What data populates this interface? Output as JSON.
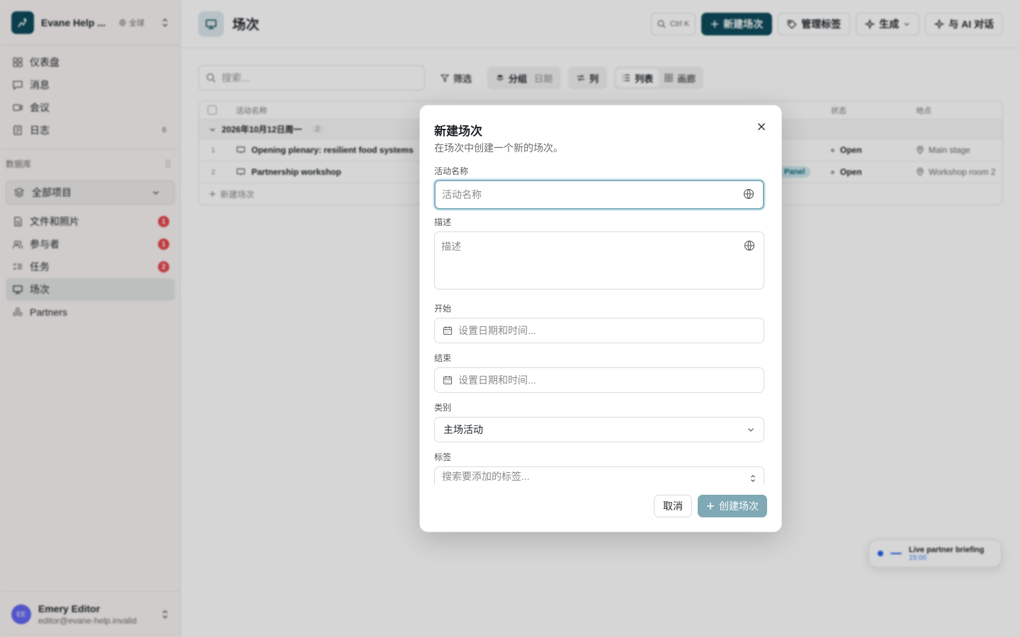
{
  "workspace": {
    "name": "Evane Help ...",
    "scope": "全球"
  },
  "nav": [
    {
      "label": "仪表盘",
      "icon": "dashboard-icon"
    },
    {
      "label": "消息",
      "icon": "message-icon"
    },
    {
      "label": "会议",
      "icon": "video-icon"
    },
    {
      "label": "日志",
      "icon": "log-icon",
      "count": "6"
    }
  ],
  "database": {
    "label": "数据库",
    "project_select": "全部项目",
    "items": [
      {
        "label": "文件和照片",
        "icon": "file-icon",
        "badge": "1"
      },
      {
        "label": "参与者",
        "icon": "users-icon",
        "badge": "1"
      },
      {
        "label": "任务",
        "icon": "tasks-icon",
        "badge": "2"
      },
      {
        "label": "场次",
        "icon": "presentation-icon",
        "active": true
      },
      {
        "label": "Partners",
        "icon": "partners-icon"
      }
    ]
  },
  "user": {
    "initials": "EE",
    "name": "Emery Editor",
    "email": "editor@evane-help.invalid"
  },
  "page": {
    "title": "场次",
    "actions": {
      "kbd": "Ctrl K",
      "new": "新建场次",
      "tags": "管理标签",
      "generate": "生成",
      "ai": "与 AI 对话"
    }
  },
  "toolbar": {
    "search_placeholder": "搜索...",
    "filter": "筛选",
    "group": "分组",
    "group_value": "日期",
    "columns": "列",
    "view_list": "列表",
    "view_gallery": "画廊"
  },
  "table": {
    "headers": {
      "name": "活动名称",
      "status": "状态",
      "location": "地点"
    },
    "group": {
      "label": "2026年10月12日周一",
      "count": "2"
    },
    "rows": [
      {
        "num": "1",
        "name": "Opening plenary: resilient food systems",
        "status": "Open",
        "location": "Main stage"
      },
      {
        "num": "2",
        "name": "Partnership workshop",
        "tag": "Panel",
        "status": "Open",
        "location": "Workshop room 2"
      }
    ],
    "add_row": "新建场次"
  },
  "floating_card": {
    "title": "Live partner briefing",
    "time": "15:00"
  },
  "dialog": {
    "title": "新建场次",
    "description": "在场次中创建一个新的场次。",
    "fields": {
      "name_label": "活动名称",
      "name_placeholder": "活动名称",
      "desc_label": "描述",
      "desc_placeholder": "描述",
      "start_label": "开始",
      "start_placeholder": "设置日期和时间...",
      "end_label": "结束",
      "end_placeholder": "设置日期和时间...",
      "category_label": "类别",
      "category_value": "主场活动",
      "tags_label": "标签",
      "tags_placeholder": "搜索要添加的标签..."
    },
    "cancel": "取消",
    "create": "创建场次"
  },
  "colors": {
    "brand": "#0f4c5c",
    "badge": "#e5484d",
    "active_nav": "#e2e4e3",
    "create_disabled": "#7fa9b5"
  }
}
